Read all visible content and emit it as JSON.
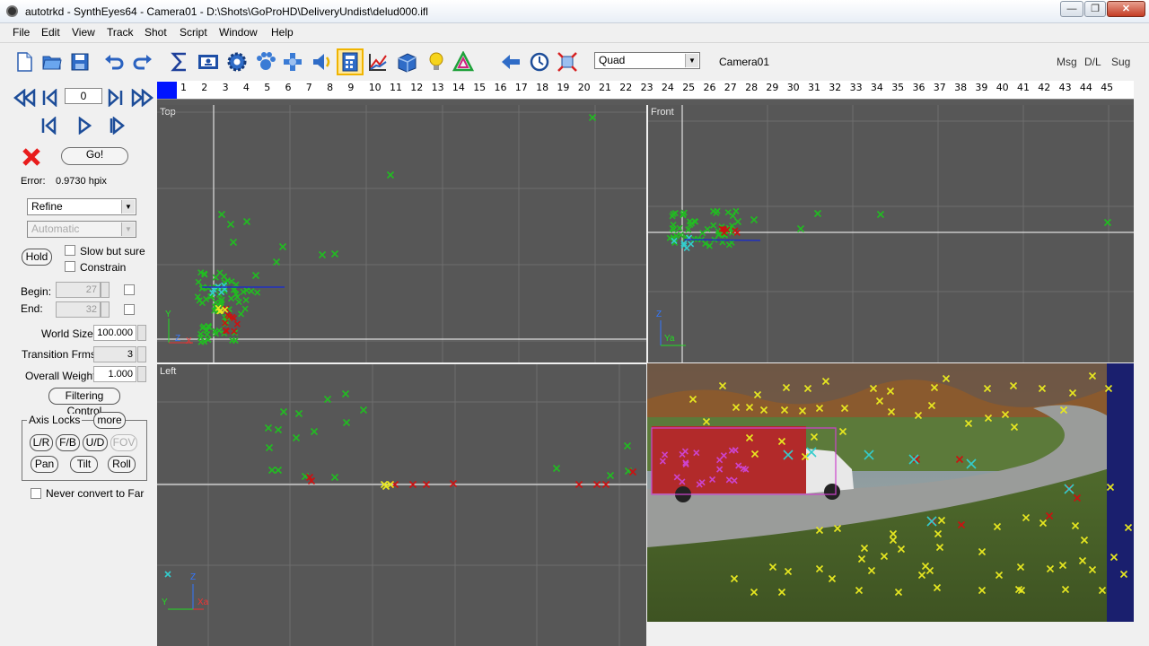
{
  "window": {
    "title": "autotrkd - SynthEyes64 - Camera01 - D:\\Shots\\GoProHD\\DeliveryUndist\\delud000.ifl",
    "min": "—",
    "max": "❐",
    "close": "✕"
  },
  "menu": [
    "File",
    "Edit",
    "View",
    "Track",
    "Shot",
    "Script",
    "Window",
    "Help"
  ],
  "toolbar": {
    "mode": "Quad",
    "camera": "Camera01",
    "msg": "Msg",
    "dl": "D/L",
    "sug": "Sug"
  },
  "icons": [
    "new-file-icon",
    "open-folder-icon",
    "save-icon",
    "undo-icon",
    "redo-icon",
    "sigma-icon",
    "id-card-icon",
    "gear-icon",
    "paw-icon",
    "move-icon",
    "sound-icon",
    "calculator-icon",
    "graph-icon",
    "cube-icon",
    "bulb-icon",
    "triangle-icon",
    "back-arrow-icon",
    "clock-icon",
    "fit-icon"
  ],
  "left": {
    "frame": "0",
    "go": "Go!",
    "error_label": "Error:",
    "error_value": "0.9730 hpix",
    "refine": "Refine",
    "automatic": "Automatic",
    "hold": "Hold",
    "slow_but_sure": "Slow but sure",
    "constrain": "Constrain",
    "begin_label": "Begin:",
    "begin_value": "27",
    "end_label": "End:",
    "end_value": "32",
    "world_size_label": "World Size",
    "world_size_value": "100.000",
    "transition_label": "Transition Frms.",
    "transition_value": "3",
    "overall_weight_label": "Overall Weight",
    "overall_weight_value": "1.000",
    "filtering": "Filtering Control",
    "axis_locks": "Axis Locks",
    "more": "more",
    "lr": "L/R",
    "fb": "F/B",
    "ud": "U/D",
    "fov": "FOV",
    "pan": "Pan",
    "tilt": "Tilt",
    "roll": "Roll",
    "never_convert": "Never convert to Far"
  },
  "ruler": {
    "ticks": [
      "1",
      "2",
      "3",
      "4",
      "5",
      "6",
      "7",
      "8",
      "9",
      "10",
      "11",
      "12",
      "13",
      "14",
      "15",
      "16",
      "17",
      "18",
      "19",
      "20",
      "21",
      "22",
      "23",
      "24",
      "25",
      "26",
      "27",
      "28",
      "29",
      "30",
      "31",
      "32",
      "33",
      "34",
      "35",
      "36",
      "37",
      "38",
      "39",
      "40",
      "41",
      "42",
      "43",
      "44",
      "45"
    ]
  },
  "viewports": {
    "top": {
      "label": "Top",
      "axis_y": "Y",
      "axis_z": "Z",
      "axis_x": "X"
    },
    "front": {
      "label": "Front",
      "axis_z": "Z",
      "axis_y": "Ya"
    },
    "left": {
      "label": "Left",
      "axis_z": "Z",
      "axis_y": "Y",
      "axis_x": "Xa"
    },
    "camera": {
      "label": "Camera01"
    }
  },
  "colors": {
    "viewport_bg": "#575757",
    "grid": "#6e6e6e",
    "axis": "#e0e0e0",
    "tracker_green": "#22bb22",
    "tracker_red": "#cc1111",
    "tracker_cyan": "#33cccc",
    "tracker_yellow": "#e8e820"
  }
}
